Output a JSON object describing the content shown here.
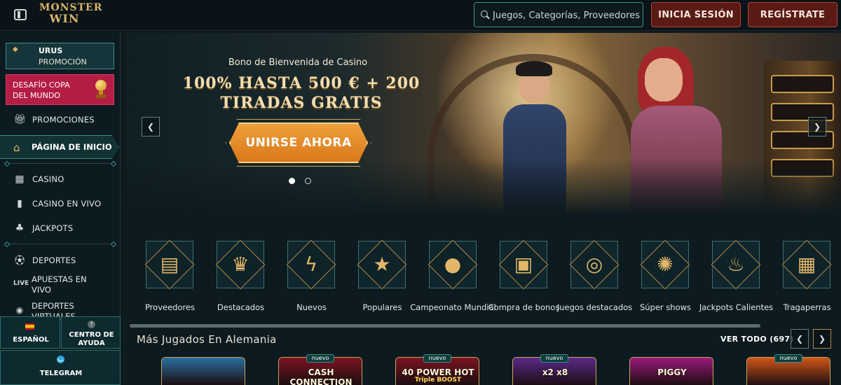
{
  "header": {
    "logo_line1": "MONSTER",
    "logo_line2": "WIN",
    "search_placeholder": "Juegos, Categorías, Proveedores",
    "login_label": "INICIA SESIÓN",
    "register_label": "REGÍSTRATE"
  },
  "sidebar": {
    "promo_urus": {
      "title": "URUS",
      "subtitle": "PROMOCIÓN"
    },
    "promo_cup": {
      "label": "DESAFÍO COPA DEL MUNDO"
    },
    "items": [
      {
        "label": "PROMOCIONES",
        "icon": "gift-icon"
      },
      {
        "label": "PÁGINA DE INICIO",
        "icon": "home-icon",
        "active": true
      },
      {
        "label": "CASINO",
        "icon": "slot-machine-icon"
      },
      {
        "label": "CASINO EN VIVO",
        "icon": "live-casino-icon"
      },
      {
        "label": "JACKPOTS",
        "icon": "clover-icon"
      },
      {
        "label": "DEPORTES",
        "icon": "soccer-ball-icon"
      },
      {
        "label": "APUESTAS EN VIVO",
        "icon": "live-badge-icon",
        "icon_text": "LIVE"
      },
      {
        "label": "DEPORTES VIRTUALES",
        "icon": "virtual-sports-icon"
      }
    ],
    "language_label": "ESPAÑOL",
    "help_label": "CENTRO DE AYUDA",
    "telegram_label": "TELEGRAM"
  },
  "hero": {
    "subtitle": "Bono de Bienvenida de Casino",
    "title": "100% HASTA 500 € + 200 TIRADAS GRATIS",
    "cta_label": "UNIRSE AHORA",
    "slides_total": 2,
    "active_slide": 1
  },
  "categories": [
    {
      "label": "Proveedores",
      "icon": "book-icon"
    },
    {
      "label": "Destacados",
      "icon": "crown-icon"
    },
    {
      "label": "Nuevos",
      "icon": "lightning-icon"
    },
    {
      "label": "Populares",
      "icon": "star-icon"
    },
    {
      "label": "Campeonato Mundial",
      "icon": "soccer-ball-icon"
    },
    {
      "label": "Compra de bonos",
      "icon": "treasure-chest-icon"
    },
    {
      "label": "Juegos destacados",
      "icon": "chip-icon"
    },
    {
      "label": "Súper shows",
      "icon": "wheel-icon"
    },
    {
      "label": "Jackpots Calientes",
      "icon": "flame-icon"
    },
    {
      "label": "Tragaperras",
      "icon": "slot-machine-icon"
    }
  ],
  "most_played": {
    "title": "Más Jugados En Alemania",
    "see_all_label": "VER TODO (697)",
    "games": [
      {
        "title": "",
        "subtitle": "",
        "badge": "",
        "color": "#2a6fa0"
      },
      {
        "title": "CASH CONNECTION",
        "subtitle": "",
        "badge": "nuevo",
        "color": "#7a1420"
      },
      {
        "title": "40 POWER HOT",
        "subtitle": "Triple BOOST",
        "badge": "nuevo",
        "color": "#7a1420"
      },
      {
        "title": "x2   x8",
        "subtitle": "",
        "badge": "nuevo",
        "color": "#5a2a8a"
      },
      {
        "title": "PIGGY",
        "subtitle": "",
        "badge": "",
        "color": "#9a1a7a"
      },
      {
        "title": "",
        "subtitle": "",
        "badge": "nuevo",
        "color": "#d0561a"
      }
    ]
  },
  "colors": {
    "accent_teal": "#3a8c86",
    "accent_gold": "#c9a35c",
    "button_red": "#5a1a16",
    "cta_orange": "#e8902c",
    "promo_pink": "#b41e44"
  }
}
